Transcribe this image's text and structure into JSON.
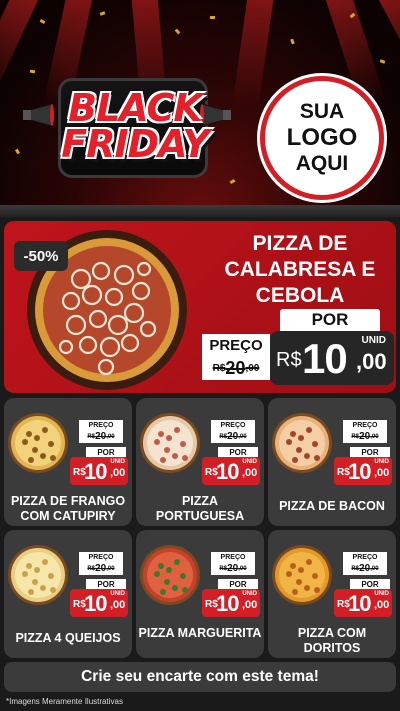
{
  "header": {
    "black_word": "BLACK",
    "friday_word": "FRIDAY",
    "logo_lines": [
      "SUA",
      "LOGO",
      "AQUI"
    ]
  },
  "featured": {
    "discount_badge": "-50%",
    "title_lines": [
      "PIZZA DE",
      "CALABRESA E",
      "CEBOLA"
    ],
    "por_label": "POR",
    "preco_label": "PREÇO",
    "old_currency": "R$",
    "old_price": "20",
    "old_cents": ",00",
    "unid_label": "UNID",
    "currency": "R$",
    "new_price": "10",
    "new_cents": ",00"
  },
  "grid": {
    "preco_label": "PREÇO",
    "por_label": "POR",
    "unid_label": "UNID",
    "old_currency": "R$",
    "old_price": "20",
    "old_cents": ",00",
    "currency": "R$",
    "new_price": "10",
    "new_cents": ",00",
    "items": [
      {
        "name": "PIZZA DE FRANGO COM CATUPIRY"
      },
      {
        "name": "PIZZA PORTUGUESA"
      },
      {
        "name": "PIZZA DE BACON"
      },
      {
        "name": "PIZZA 4 QUEIJOS"
      },
      {
        "name": "PIZZA MARGUERITA"
      },
      {
        "name": "PIZZA COM DORITOS"
      }
    ]
  },
  "footer": {
    "cta": "Crie seu encarte com este tema!",
    "disclaimer": "*Imagens Meramente Ilustrativas"
  },
  "colors": {
    "brand_red": "#d41e25",
    "dark_card": "#3b3b3b"
  }
}
